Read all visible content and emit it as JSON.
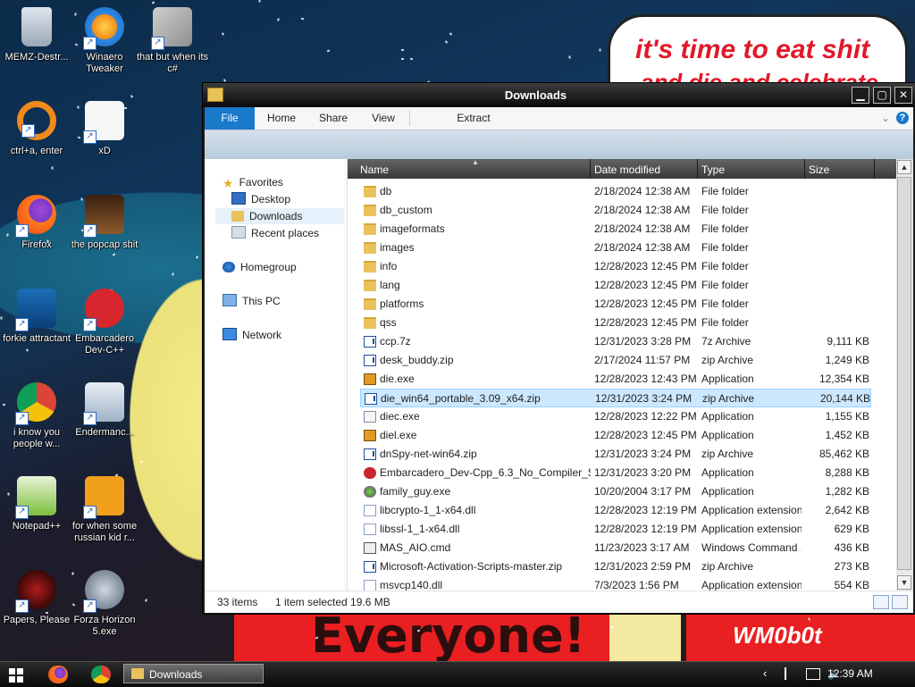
{
  "wallpaper": {
    "banner_top": {
      "line1": "it's time to eat shit",
      "line2": "and die and celebrate"
    },
    "banner_bottom": "Everyone!",
    "bottom_right": "WM0b0t"
  },
  "desktop_icons": [
    {
      "label": "MEMZ-Destr...",
      "icon": "recycle-bin-icon"
    },
    {
      "label": "Winaero Tweaker",
      "icon": "winaero-icon"
    },
    {
      "label": "that but when its c#",
      "icon": "stacked-windows-icon"
    },
    {
      "label": "ctrl+a, enter",
      "icon": "orange-ring-icon"
    },
    {
      "label": "xD",
      "icon": "xd-icon"
    },
    {
      "label": "Firefox",
      "icon": "firefox-icon"
    },
    {
      "label": "the popcap shit",
      "icon": "popcap-icon"
    },
    {
      "label": "forkie attractant",
      "icon": "monitor-gear-icon"
    },
    {
      "label": "Embarcadero Dev-C++",
      "icon": "devcpp-icon"
    },
    {
      "label": "i know you people w...",
      "icon": "chrome-icon"
    },
    {
      "label": "Endermanc...",
      "icon": "window-app-icon"
    },
    {
      "label": "Notepad++",
      "icon": "notepadpp-icon"
    },
    {
      "label": "for when some russian kid r...",
      "icon": "die-icon"
    },
    {
      "label": "Papers, Please",
      "icon": "papers-please-icon"
    },
    {
      "label": "Forza Horizon 5.exe",
      "icon": "flash-icon"
    }
  ],
  "window": {
    "title": "Downloads",
    "ribbon_tabs": [
      "File",
      "Home",
      "Share",
      "View",
      "Extract"
    ],
    "nav": {
      "favorites": "Favorites",
      "desktop": "Desktop",
      "downloads": "Downloads",
      "recent": "Recent places",
      "homegroup": "Homegroup",
      "this_pc": "This PC",
      "network": "Network"
    },
    "columns": {
      "name": "Name",
      "date": "Date modified",
      "type": "Type",
      "size": "Size"
    },
    "files": [
      {
        "name": "db",
        "date": "2/18/2024 12:38 AM",
        "type": "File folder",
        "size": "",
        "icon": "folder"
      },
      {
        "name": "db_custom",
        "date": "2/18/2024 12:38 AM",
        "type": "File folder",
        "size": "",
        "icon": "folder"
      },
      {
        "name": "imageformats",
        "date": "2/18/2024 12:38 AM",
        "type": "File folder",
        "size": "",
        "icon": "folder"
      },
      {
        "name": "images",
        "date": "2/18/2024 12:38 AM",
        "type": "File folder",
        "size": "",
        "icon": "folder"
      },
      {
        "name": "info",
        "date": "12/28/2023 12:45 PM",
        "type": "File folder",
        "size": "",
        "icon": "folder"
      },
      {
        "name": "lang",
        "date": "12/28/2023 12:45 PM",
        "type": "File folder",
        "size": "",
        "icon": "folder"
      },
      {
        "name": "platforms",
        "date": "12/28/2023 12:45 PM",
        "type": "File folder",
        "size": "",
        "icon": "folder"
      },
      {
        "name": "qss",
        "date": "12/28/2023 12:45 PM",
        "type": "File folder",
        "size": "",
        "icon": "folder"
      },
      {
        "name": "ccp.7z",
        "date": "12/31/2023 3:28 PM",
        "type": "7z Archive",
        "size": "9,111 KB",
        "icon": "zip"
      },
      {
        "name": "desk_buddy.zip",
        "date": "2/17/2024 11:57 PM",
        "type": "zip Archive",
        "size": "1,249 KB",
        "icon": "zip"
      },
      {
        "name": "die.exe",
        "date": "12/28/2023 12:43 PM",
        "type": "Application",
        "size": "12,354 KB",
        "icon": "app"
      },
      {
        "name": "die_win64_portable_3.09_x64.zip",
        "date": "12/31/2023 3:24 PM",
        "type": "zip Archive",
        "size": "20,144 KB",
        "icon": "zip",
        "selected": true
      },
      {
        "name": "diec.exe",
        "date": "12/28/2023 12:22 PM",
        "type": "Application",
        "size": "1,155 KB",
        "icon": "generic"
      },
      {
        "name": "diel.exe",
        "date": "12/28/2023 12:45 PM",
        "type": "Application",
        "size": "1,452 KB",
        "icon": "app"
      },
      {
        "name": "dnSpy-net-win64.zip",
        "date": "12/31/2023 3:24 PM",
        "type": "zip Archive",
        "size": "85,462 KB",
        "icon": "zip"
      },
      {
        "name": "Embarcadero_Dev-Cpp_6.3_No_Compiler_S...",
        "date": "12/31/2023 3:20 PM",
        "type": "Application",
        "size": "8,288 KB",
        "icon": "red"
      },
      {
        "name": "family_guy.exe",
        "date": "10/20/2004 3:17 PM",
        "type": "Application",
        "size": "1,282 KB",
        "icon": "fg"
      },
      {
        "name": "libcrypto-1_1-x64.dll",
        "date": "12/28/2023 12:19 PM",
        "type": "Application extension",
        "size": "2,642 KB",
        "icon": "dll"
      },
      {
        "name": "libssl-1_1-x64.dll",
        "date": "12/28/2023 12:19 PM",
        "type": "Application extension",
        "size": "629 KB",
        "icon": "dll"
      },
      {
        "name": "MAS_AIO.cmd",
        "date": "11/23/2023 3:17 AM",
        "type": "Windows Command ...",
        "size": "436 KB",
        "icon": "cmd"
      },
      {
        "name": "Microsoft-Activation-Scripts-master.zip",
        "date": "12/31/2023 2:59 PM",
        "type": "zip Archive",
        "size": "273 KB",
        "icon": "zip"
      },
      {
        "name": "msvcp140.dll",
        "date": "7/3/2023 1:56 PM",
        "type": "Application extension",
        "size": "554 KB",
        "icon": "dll"
      }
    ],
    "status": {
      "count": "33 items",
      "selected": "1 item selected  19.6 MB"
    }
  },
  "taskbar": {
    "downloads_label": "Downloads",
    "clock": "12:39 AM"
  }
}
